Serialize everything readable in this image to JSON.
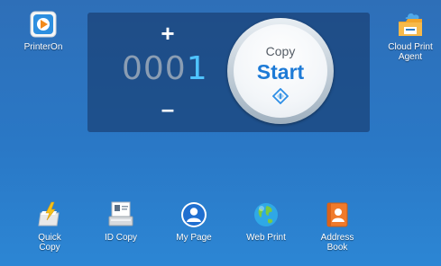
{
  "top_apps": {
    "printeron": {
      "label": "PrinterOn",
      "icon": "printeron-icon"
    },
    "cloud_print": {
      "label": "Cloud Print\nAgent",
      "icon": "cloud-print-icon"
    }
  },
  "copy_panel": {
    "increment_label": "+",
    "decrement_label": "–",
    "count_dim": "000",
    "count_bright": "1",
    "start": {
      "top_label": "Copy",
      "main_label": "Start"
    }
  },
  "dock": {
    "quick_copy": "Quick\nCopy",
    "id_copy": "ID Copy",
    "my_page": "My Page",
    "web_print": "Web Print",
    "address_book": "Address\nBook"
  },
  "colors": {
    "background": "#2a78c6",
    "panel": "#14325f",
    "count_active": "#4fc3ff",
    "start_text": "#1d7ad6"
  }
}
